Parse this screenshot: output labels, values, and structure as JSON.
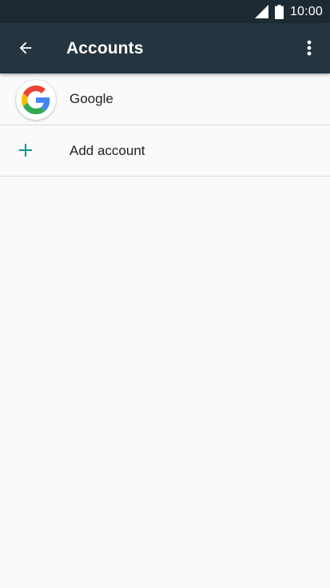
{
  "status_bar": {
    "time": "10:00",
    "icons": [
      "signal-icon",
      "battery-icon"
    ]
  },
  "app_bar": {
    "title": "Accounts",
    "icons": [
      "back-arrow-icon",
      "more-vert-icon"
    ]
  },
  "accounts": {
    "items": [
      {
        "label": "Google",
        "icon": "google-logo-icon"
      }
    ],
    "add_item": {
      "label": "Add account",
      "icon": "plus-icon"
    }
  },
  "colors": {
    "status_bar_bg": "#1d2a33",
    "app_bar_bg": "#25343f",
    "page_bg": "#fafafa",
    "accent_teal": "#009688",
    "google_blue": "#4285F4",
    "google_red": "#EA4335",
    "google_yellow": "#FBBC05",
    "google_green": "#34A853"
  }
}
